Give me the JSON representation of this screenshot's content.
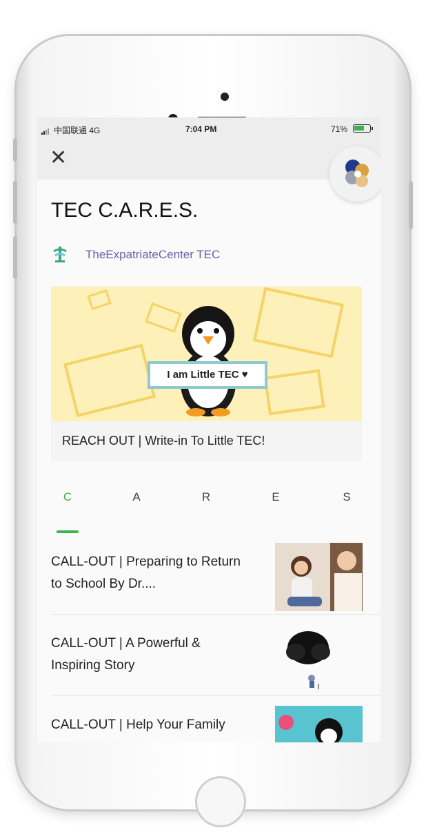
{
  "status_bar": {
    "carrier": "中国联通 4G",
    "time": "7:04 PM",
    "battery": "71%",
    "battery_fraction": 0.71
  },
  "nav": {
    "close_icon": "close-icon"
  },
  "page": {
    "title": "TEC C.A.R.E.S.",
    "author": "TheExpatriateCenter TEC"
  },
  "banner": {
    "sign_text": "I am Little TEC ♥",
    "caption": "REACH OUT | Write-in To Little TEC!"
  },
  "tabs": [
    "C",
    "A",
    "R",
    "E",
    "S"
  ],
  "active_tab": 0,
  "articles": [
    {
      "title": "CALL-OUT | Preparing to Return to School By Dr...."
    },
    {
      "title": "CALL-OUT | A Powerful & Inspiring Story"
    },
    {
      "title": "CALL-OUT | Help Your Family"
    }
  ],
  "colors": {
    "accent": "#3bb34a",
    "author": "#6a5fa8",
    "banner_bg": "#fdf0b8"
  }
}
